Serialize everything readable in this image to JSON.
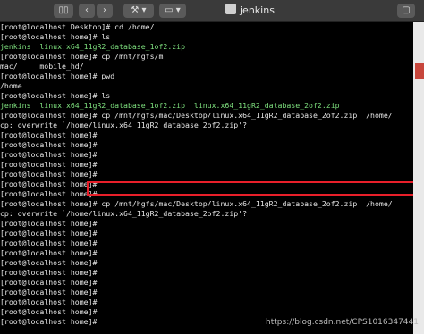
{
  "window": {
    "title": "jenkins"
  },
  "terminal": {
    "lines": [
      "[root@localhost Desktop]# cd /home/",
      "[root@localhost home]# ls",
      "jenkins  linux.x64_11gR2_database_1of2.zip",
      "[root@localhost home]# cp /mnt/hgfs/m",
      "mac/     mobile_hd/",
      "[root@localhost home]# pwd",
      "/home",
      "[root@localhost home]# ls",
      "jenkins  linux.x64_11gR2_database_1of2.zip  linux.x64_11gR2_database_2of2.zip",
      "[root@localhost home]# cp /mnt/hgfs/mac/Desktop/linux.x64_11gR2_database_2of2.zip  /home/",
      "cp: overwrite `/home/linux.x64_11gR2_database_2of2.zip'?",
      "[root@localhost home]#",
      "[root@localhost home]#",
      "[root@localhost home]#",
      "[root@localhost home]#",
      "[root@localhost home]#",
      "[root@localhost home]#",
      "[root@localhost home]#",
      "[root@localhost home]# cp /mnt/hgfs/mac/Desktop/linux.x64_11gR2_database_2of2.zip  /home/",
      "cp: overwrite `/home/linux.x64_11gR2_database_2of2.zip'?",
      "[root@localhost home]#",
      "[root@localhost home]#",
      "[root@localhost home]#",
      "[root@localhost home]#",
      "[root@localhost home]#",
      "[root@localhost home]#",
      "[root@localhost home]#",
      "[root@localhost home]#",
      "[root@localhost home]#",
      "[root@localhost home]#",
      "[root@localhost home]#"
    ]
  },
  "watermark": "https://blog.csdn.net/CPS1016347441",
  "colors": {
    "highlight": "#e81f2a",
    "listing": "#7ee07e"
  }
}
